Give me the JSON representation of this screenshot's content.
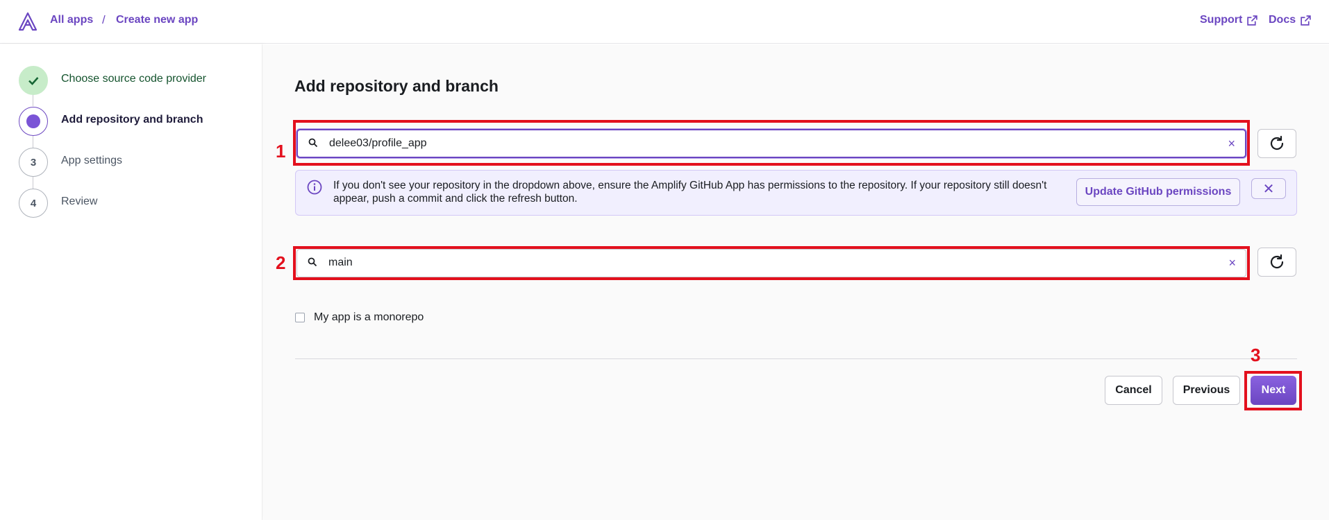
{
  "header": {
    "breadcrumb": [
      "All apps",
      "Create new app"
    ],
    "separator": "/",
    "links": [
      {
        "label": "Support"
      },
      {
        "label": "Docs"
      }
    ]
  },
  "steps": [
    {
      "number": "",
      "label": "Choose source code provider",
      "state": "completed"
    },
    {
      "number": "",
      "label": "Add repository and branch",
      "state": "current"
    },
    {
      "number": "3",
      "label": "App settings",
      "state": "pending"
    },
    {
      "number": "4",
      "label": "Review",
      "state": "pending"
    }
  ],
  "main": {
    "title": "Add repository and branch",
    "repository_value": "delee03/profile_app",
    "branch_value": "main",
    "clear_glyph": "×",
    "info_text": "If you don't see your repository in the dropdown above, ensure the Amplify GitHub App has permissions to the repository. If your repository still doesn't appear, push a commit and click the refresh button.",
    "update_permissions_label": "Update GitHub permissions",
    "dismiss_glyph": "✕",
    "monorepo_label": "My app is a monorepo",
    "monorepo_checked": false,
    "buttons": {
      "cancel": "Cancel",
      "previous": "Previous",
      "next": "Next"
    }
  },
  "annotations": [
    "1",
    "2",
    "3"
  ],
  "colors": {
    "accent": "#6b46c1",
    "annotation": "#e3101d",
    "success": "#c7ecc9"
  },
  "icons": [
    "amplify-logo-icon",
    "external-link-icon",
    "checkmark-icon",
    "search-icon",
    "clear-icon",
    "refresh-icon",
    "info-icon",
    "close-icon"
  ]
}
